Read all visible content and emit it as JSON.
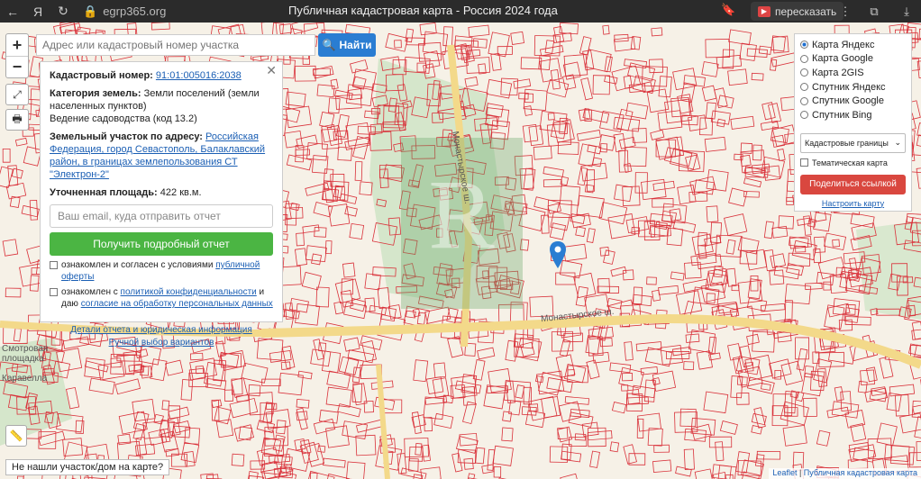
{
  "browser": {
    "url": "egrp365.org",
    "page_title": "Публичная кадастровая карта - Россия 2024 года",
    "retell_label": "пересказать"
  },
  "search": {
    "placeholder": "Адрес или кадастровый номер участка",
    "button_label": "Найти"
  },
  "info": {
    "cadastral_label": "Кадастровый номер:",
    "cadastral_value": "91:01:005016:2038",
    "category_label": "Категория земель:",
    "category_value": "Земли поселений (земли населенных пунктов)",
    "use_value": "Ведение садоводства (код 13.2)",
    "address_label": "Земельный участок по адресу:",
    "address_value": "Российская Федерация, город Севастополь, Балаклавский район, в границах землепользования СТ \"Электрон-2\"",
    "area_label": "Уточненная площадь:",
    "area_value": "422 кв.м.",
    "email_placeholder": "Ваш email, куда отправить отчет",
    "report_button": "Получить подробный отчет",
    "consent1_text": "ознакомлен и согласен с условиями",
    "consent1_link": "публичной оферты",
    "consent2_text": "ознакомлен с",
    "consent2_link": "политикой конфиденциальности",
    "consent2_tail": "и даю",
    "consent2_link2": "согласие на обработку персональных данных",
    "details_link": "Детали отчета и юридическая информация",
    "manual_link": "Ручной выбор вариантов"
  },
  "layers": {
    "options": [
      "Карта Яндекс",
      "Карта Google",
      "Карта 2GIS",
      "Спутник Яндекс",
      "Спутник Google",
      "Спутник Bing"
    ],
    "selected": "Карта Яндекс",
    "overlay_select": "Кадастровые границы",
    "thematic_label": "Тематическая карта",
    "share_button": "Поделиться ссылкой",
    "setup_link": "Настроить карту"
  },
  "map": {
    "road_labels": [
      "Монастырское ш.",
      "Монастырское ш.",
      "Смотровая площадка",
      "Каравелла"
    ],
    "not_found": "Не нашли участок/дом на карте?",
    "attribution_leaflet": "Leaflet",
    "attribution_text": "Публичная кадастровая карта"
  },
  "colors": {
    "parcel": "#d9313a",
    "road": "#f3d98a",
    "green": "#6aa56a",
    "accent": "#2a7dd2",
    "report": "#4bb543",
    "share": "#d9473f"
  }
}
